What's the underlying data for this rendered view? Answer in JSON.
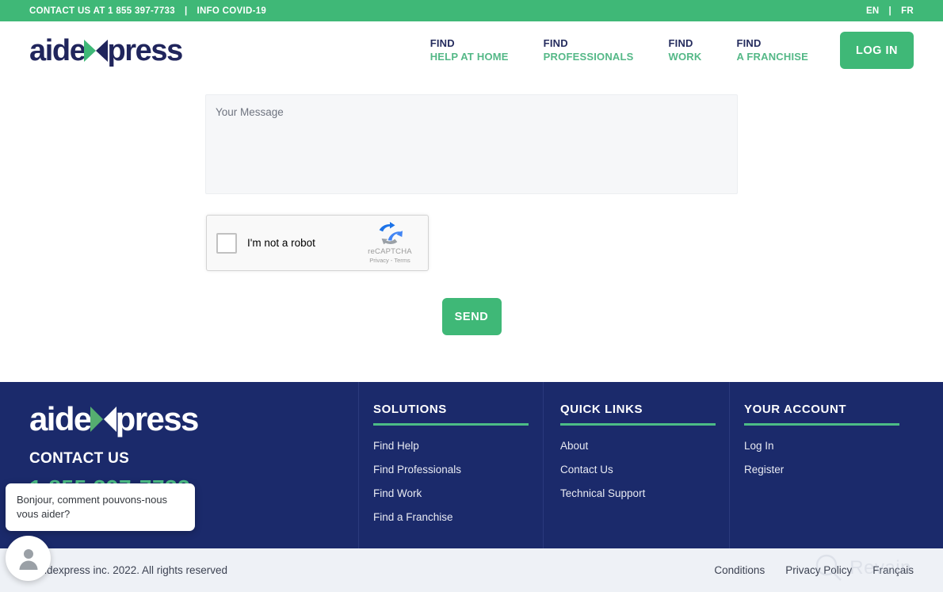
{
  "topbar": {
    "contact_text": "CONTACT US AT 1 855 397-7733",
    "separator": "|",
    "covid_link": "INFO COVID-19",
    "lang_en": "EN",
    "lang_sep": "|",
    "lang_fr": "FR",
    "background_color": "#3fb877"
  },
  "header": {
    "logo": {
      "part1": "aide",
      "part2": "press",
      "icon": "x-arrows-mark"
    },
    "nav": [
      {
        "line1": "FIND",
        "line2": "HELP AT HOME"
      },
      {
        "line1": "FIND",
        "line2": "PROFESSIONALS"
      },
      {
        "line1": "FIND",
        "line2": "WORK"
      },
      {
        "line1": "FIND",
        "line2": "A FRANCHISE"
      }
    ],
    "login_label": "LOG IN",
    "accent_navy": "#20255c",
    "accent_green": "#54b887"
  },
  "main": {
    "message_placeholder": "Your Message",
    "message_value": "",
    "recaptcha": {
      "checkbox_label": "I'm not a robot",
      "brand": "reCAPTCHA",
      "privacy": "Privacy",
      "dot": "-",
      "terms": "Terms",
      "checked": false
    },
    "send_label": "SEND"
  },
  "footer": {
    "logo": {
      "part1": "aide",
      "part2": "press",
      "icon": "x-arrows-mark"
    },
    "contact_title": "CONTACT US",
    "contact_phone": "1 855 397-7733",
    "columns": [
      {
        "heading": "SOLUTIONS",
        "links": [
          "Find Help",
          "Find Professionals",
          "Find Work",
          "Find a Franchise"
        ]
      },
      {
        "heading": "QUICK LINKS",
        "links": [
          "About",
          "Contact Us",
          "Technical Support"
        ]
      },
      {
        "heading": "YOUR ACCOUNT",
        "links": [
          "Log In",
          "Register"
        ]
      }
    ],
    "background_color": "#1b2a6b",
    "rule_color": "#4cbd86"
  },
  "bottombar": {
    "copyright": "©Aidexpress inc. 2022. All rights reserved",
    "links": [
      "Conditions",
      "Privacy Policy",
      "Français"
    ],
    "background_color": "#eef1f6"
  },
  "chat": {
    "message": "Bonjour, comment pouvons-nous vous aider?",
    "avatar_icon": "person-icon"
  },
  "watermark": {
    "text": "Revain",
    "icon": "magnifier-icon"
  }
}
